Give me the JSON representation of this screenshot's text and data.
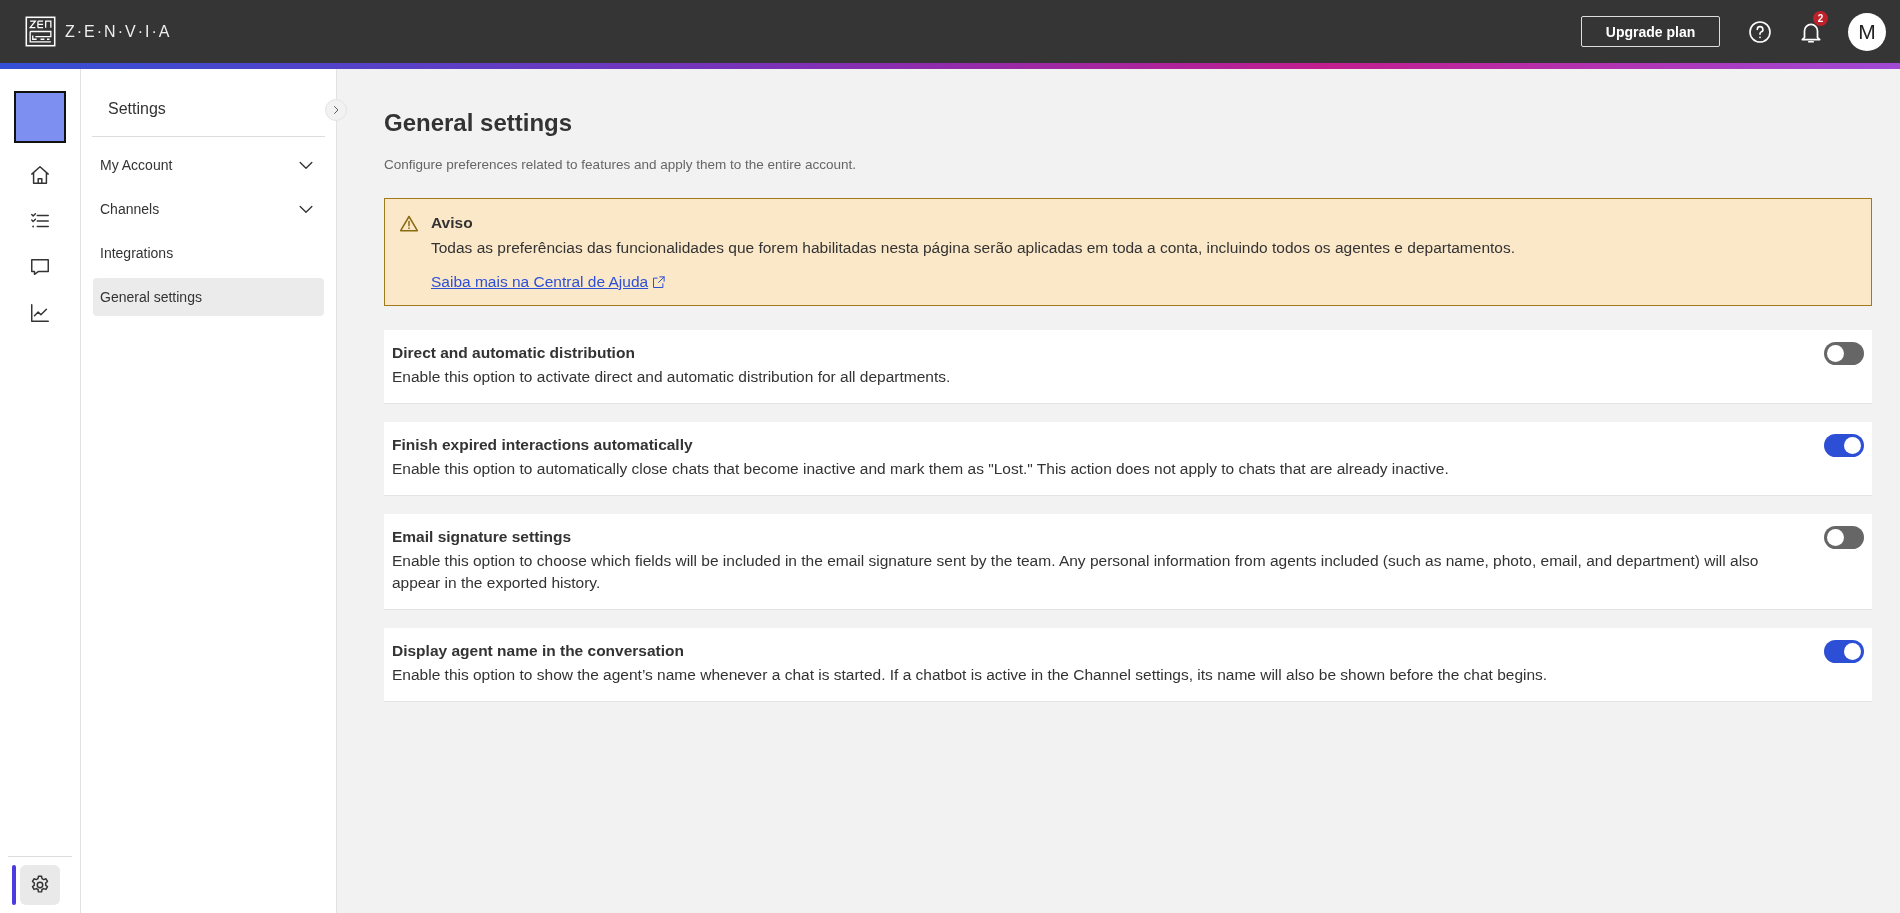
{
  "topbar": {
    "logo_text": "Z·E·N·V·I·A",
    "upgrade_button": "Upgrade plan",
    "notification_count": "2",
    "avatar_initial": "M"
  },
  "nav_rail": {
    "items": [
      {
        "kind": "home",
        "selected": false
      },
      {
        "kind": "tasks",
        "selected": false
      },
      {
        "kind": "chat",
        "selected": false
      },
      {
        "kind": "chart",
        "selected": false
      },
      {
        "kind": "settings",
        "selected": true
      }
    ]
  },
  "settings_menu": {
    "title": "Settings",
    "items": [
      {
        "label": "My Account",
        "expandable": true,
        "selected": false
      },
      {
        "label": "Channels",
        "expandable": true,
        "selected": false
      },
      {
        "label": "Integrations",
        "expandable": false,
        "selected": false
      },
      {
        "label": "General settings",
        "expandable": false,
        "selected": true
      }
    ]
  },
  "page": {
    "title": "General settings",
    "subtitle": "Configure preferences related to features and apply them to the entire account."
  },
  "notice": {
    "title": "Aviso",
    "message": "Todas as preferências das funcionalidades que forem habilitadas nesta página serão aplicadas em toda a conta, incluindo todos os agentes e departamentos.",
    "link": "Saiba mais na Central de Ajuda"
  },
  "options": [
    {
      "title": "Direct and automatic distribution",
      "description": "Enable this option to activate direct and automatic distribution for all departments.",
      "on": false
    },
    {
      "title": "Finish expired interactions automatically",
      "description": "Enable this option to automatically close chats that become inactive and mark them as \"Lost.\" This action does not apply to chats that are already inactive.",
      "on": true
    },
    {
      "title": "Email signature settings",
      "description": "Enable this option to choose which fields will be included in the email signature sent by the team. Any personal information from agents included (such as name, photo, email, and department) will also appear in the exported history.",
      "on": false
    },
    {
      "title": "Display agent name in the conversation",
      "description": "Enable this option to show the agent’s name whenever a chat is started. If a chatbot is active in the Channel settings, its name will also be shown before the chat begins.",
      "on": true
    }
  ]
}
